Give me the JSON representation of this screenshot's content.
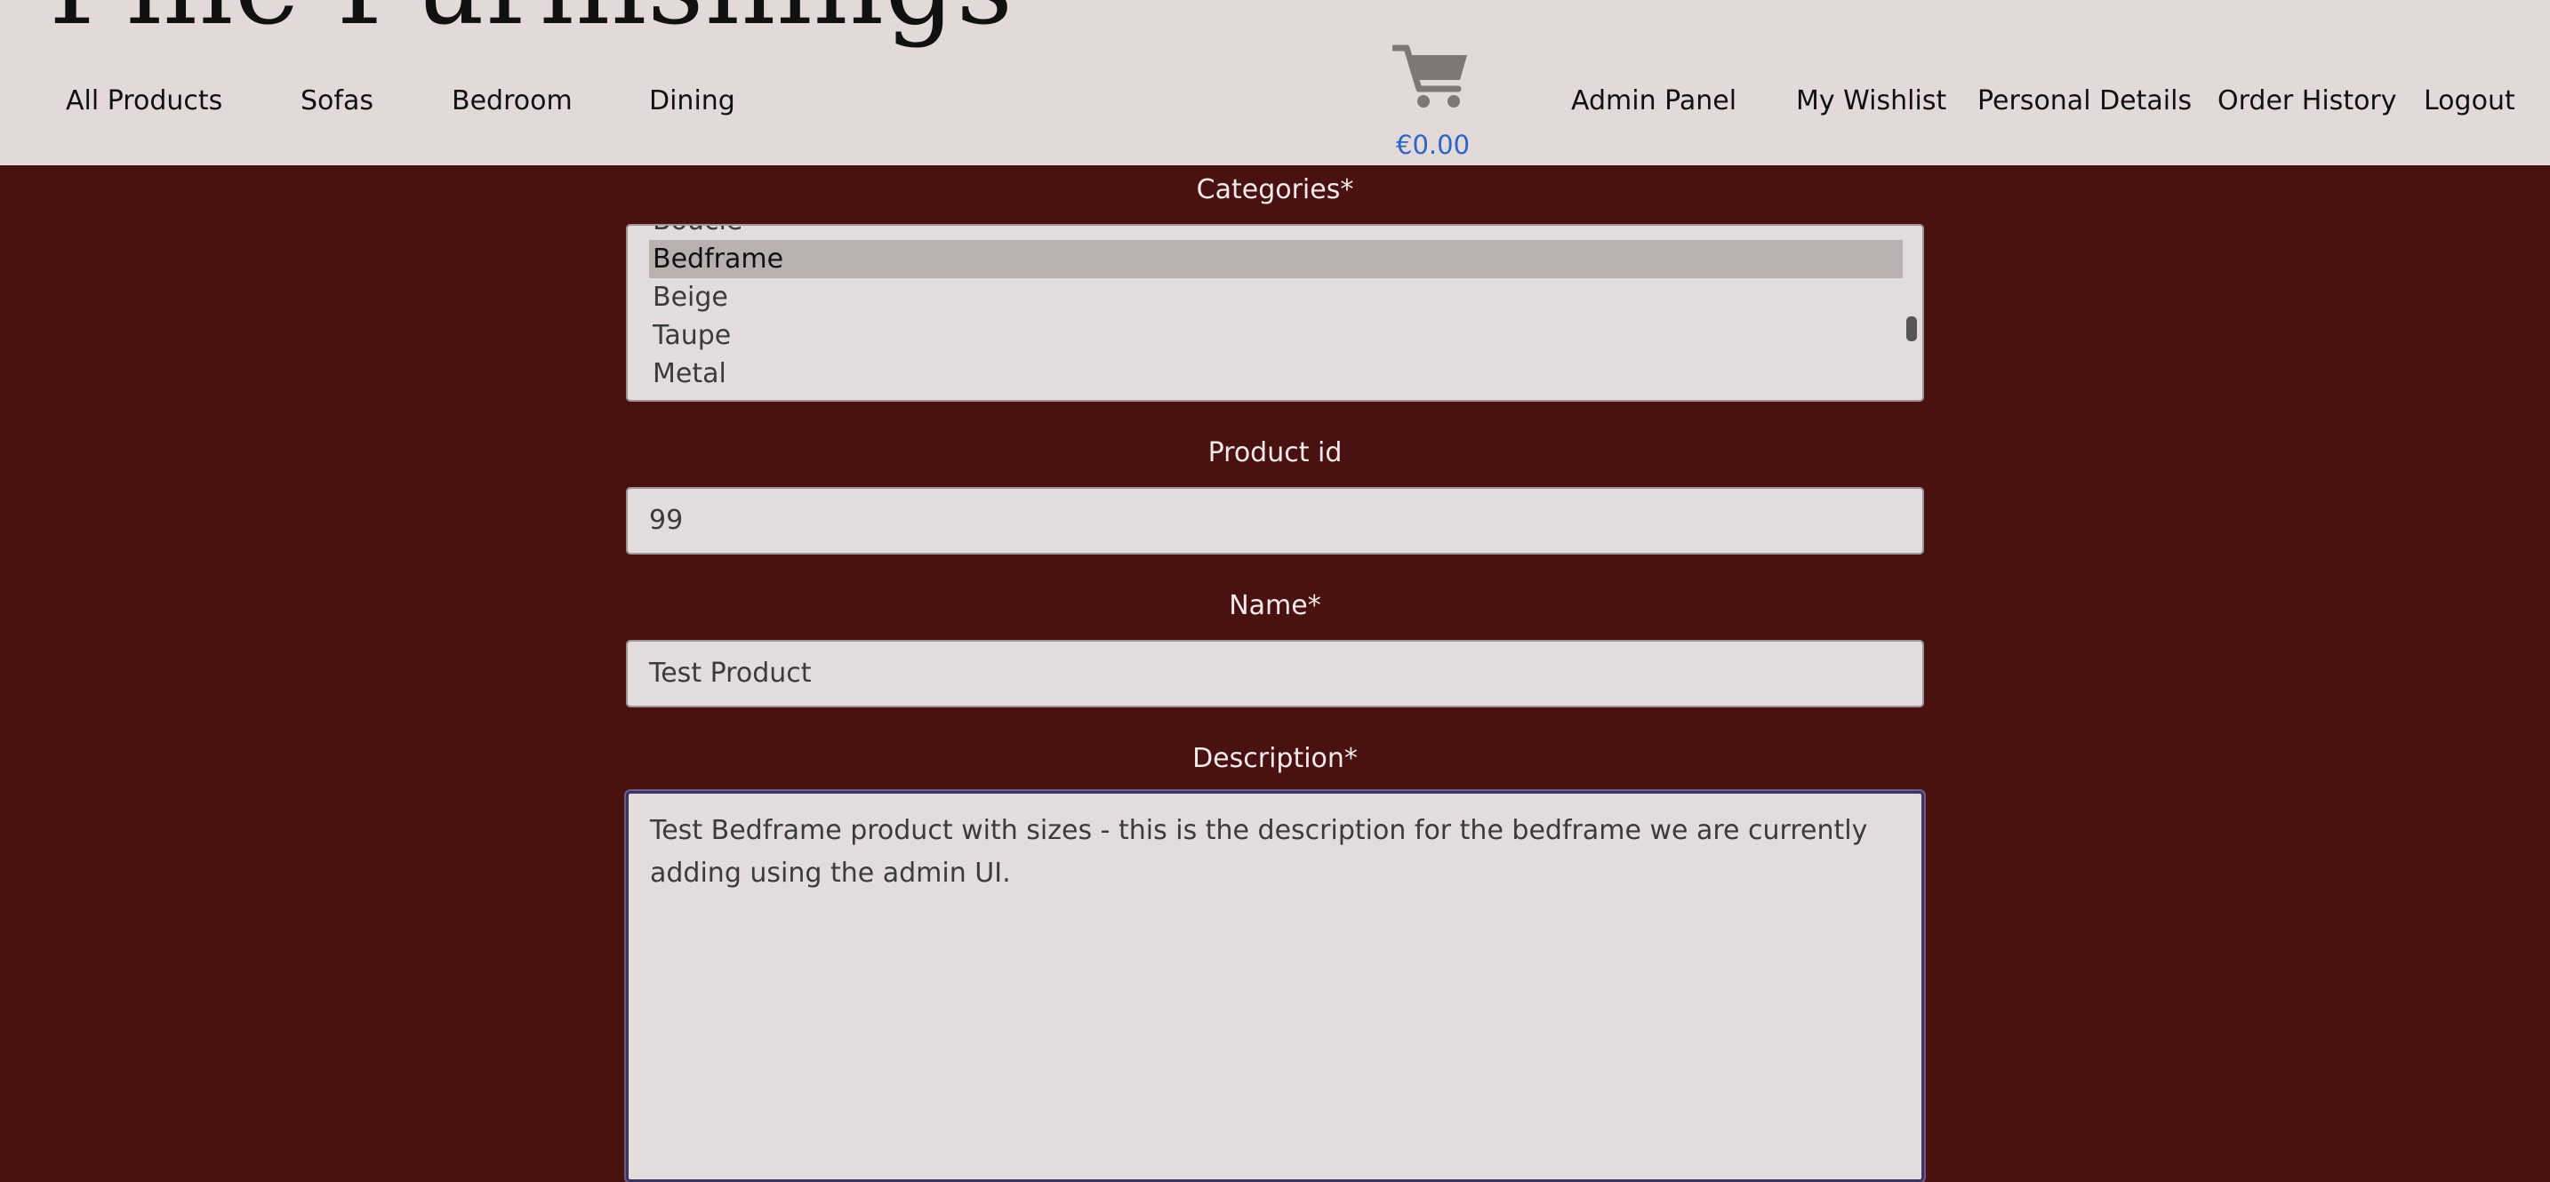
{
  "brand": {
    "logo_text": "Fine Furnishings"
  },
  "nav_left": [
    "All Products",
    "Sofas",
    "Bedroom",
    "Dining"
  ],
  "cart": {
    "total": "€0.00",
    "icon": "cart-icon"
  },
  "nav_right": [
    "Admin Panel",
    "My Wishlist",
    "Personal Details",
    "Order History",
    "Logout"
  ],
  "form": {
    "categories": {
      "label": "Categories*",
      "options": [
        "Boucle",
        "Bedframe",
        "Beige",
        "Taupe",
        "Metal"
      ],
      "selected": "Bedframe"
    },
    "product_id": {
      "label": "Product id",
      "value": "99"
    },
    "name": {
      "label": "Name*",
      "value": "Test Product"
    },
    "description": {
      "label": "Description*",
      "value": "Test Bedframe product with sizes - this is the description for the bedframe we are currently adding using the admin UI."
    }
  },
  "colors": {
    "header_bg": "#e2d9d8",
    "page_bg": "#4a1111",
    "price_link": "#2a66c8",
    "field_bg": "#e3dcdc",
    "selected_option_bg": "#b9b0b0"
  }
}
